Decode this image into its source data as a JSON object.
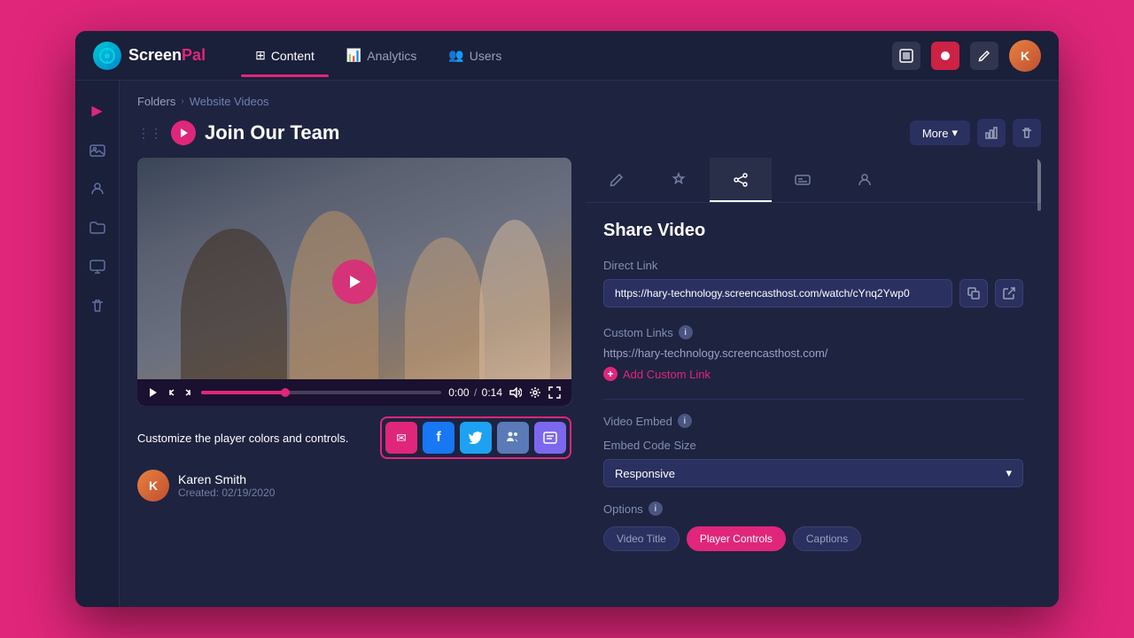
{
  "app": {
    "name": "ScreenPal",
    "logo_symbol": "🎬"
  },
  "nav": {
    "tabs": [
      {
        "id": "content",
        "label": "Content",
        "icon": "⊞",
        "active": true
      },
      {
        "id": "analytics",
        "label": "Analytics",
        "icon": "📊",
        "active": false
      },
      {
        "id": "users",
        "label": "Users",
        "icon": "👥",
        "active": false
      }
    ],
    "icons": [
      {
        "id": "capture",
        "symbol": "⊡"
      },
      {
        "id": "record",
        "symbol": "⏺"
      },
      {
        "id": "edit",
        "symbol": "✏"
      }
    ]
  },
  "sidebar": {
    "items": [
      {
        "id": "play",
        "symbol": "▶",
        "active": true
      },
      {
        "id": "image",
        "symbol": "🖼"
      },
      {
        "id": "user",
        "symbol": "👤"
      },
      {
        "id": "folder",
        "symbol": "📁"
      },
      {
        "id": "screen",
        "symbol": "🖥"
      },
      {
        "id": "trash",
        "symbol": "🗑"
      }
    ]
  },
  "breadcrumb": {
    "folders": "Folders",
    "separator": "▶",
    "current": "Website Videos"
  },
  "video": {
    "title": "Join Our Team",
    "more_btn": "More",
    "time_current": "0:00",
    "time_separator": "/",
    "time_total": "0:14",
    "creator": "Karen Smith",
    "created_label": "Created:",
    "created_date": "02/19/2020"
  },
  "customize_text": {
    "prefix": "Customize",
    "suffix": "the player colors and controls."
  },
  "social_share": {
    "buttons": [
      {
        "id": "email",
        "symbol": "✉"
      },
      {
        "id": "facebook",
        "symbol": "f"
      },
      {
        "id": "twitter",
        "symbol": "🐦"
      },
      {
        "id": "teams1",
        "symbol": "👥"
      },
      {
        "id": "teams2",
        "symbol": "📋"
      }
    ]
  },
  "panel": {
    "tabs": [
      {
        "id": "edit",
        "symbol": "✏",
        "active": false
      },
      {
        "id": "effects",
        "symbol": "✨",
        "active": false
      },
      {
        "id": "share",
        "symbol": "🔗",
        "active": true
      },
      {
        "id": "captions",
        "symbol": "▬",
        "active": false
      },
      {
        "id": "access",
        "symbol": "👤",
        "active": false
      }
    ],
    "share": {
      "title": "Share Video",
      "direct_link_label": "Direct Link",
      "direct_link_url": "https://hary-technology.screencasthost.com/watch/cYnq2Ywp0",
      "custom_links_label": "Custom Links",
      "custom_links_url": "https://hary-technology.screencasthost.com/",
      "add_custom_link": "Add Custom Link",
      "video_embed_label": "Video Embed",
      "embed_size_label": "Embed Code Size",
      "embed_size_value": "Responsive",
      "options_label": "Options",
      "option_btns": [
        {
          "id": "video_title",
          "label": "Video Title",
          "active": false
        },
        {
          "id": "player_controls",
          "label": "Player Controls",
          "active": true
        },
        {
          "id": "captions",
          "label": "Captions",
          "active": false
        }
      ]
    }
  }
}
